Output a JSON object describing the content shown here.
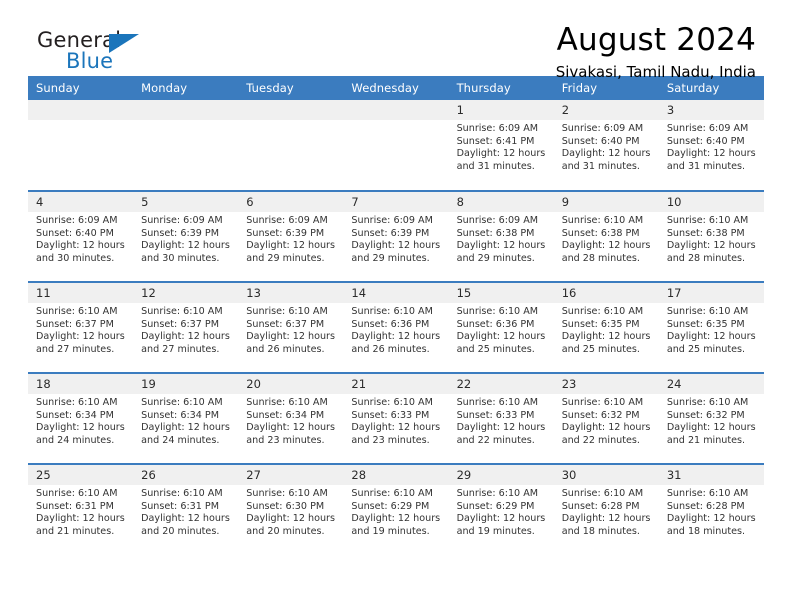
{
  "brand": {
    "name_part1": "General",
    "name_part2": "Blue",
    "triangle_icon": "triangle-icon",
    "color_dark": "#231f20",
    "color_blue": "#1b75bb"
  },
  "header": {
    "title": "August 2024",
    "subtitle": "Sivakasi, Tamil Nadu, India",
    "accent_color": "#3b7cbf",
    "daynum_bg": "#f0f0f0"
  },
  "weekday_headers": [
    "Sunday",
    "Monday",
    "Tuesday",
    "Wednesday",
    "Thursday",
    "Friday",
    "Saturday"
  ],
  "weeks": [
    [
      {
        "day": "",
        "sunrise": "",
        "sunset": "",
        "daylight_line1": "",
        "daylight_line2": ""
      },
      {
        "day": "",
        "sunrise": "",
        "sunset": "",
        "daylight_line1": "",
        "daylight_line2": ""
      },
      {
        "day": "",
        "sunrise": "",
        "sunset": "",
        "daylight_line1": "",
        "daylight_line2": ""
      },
      {
        "day": "",
        "sunrise": "",
        "sunset": "",
        "daylight_line1": "",
        "daylight_line2": ""
      },
      {
        "day": "1",
        "sunrise": "Sunrise: 6:09 AM",
        "sunset": "Sunset: 6:41 PM",
        "daylight_line1": "Daylight: 12 hours",
        "daylight_line2": "and 31 minutes."
      },
      {
        "day": "2",
        "sunrise": "Sunrise: 6:09 AM",
        "sunset": "Sunset: 6:40 PM",
        "daylight_line1": "Daylight: 12 hours",
        "daylight_line2": "and 31 minutes."
      },
      {
        "day": "3",
        "sunrise": "Sunrise: 6:09 AM",
        "sunset": "Sunset: 6:40 PM",
        "daylight_line1": "Daylight: 12 hours",
        "daylight_line2": "and 31 minutes."
      }
    ],
    [
      {
        "day": "4",
        "sunrise": "Sunrise: 6:09 AM",
        "sunset": "Sunset: 6:40 PM",
        "daylight_line1": "Daylight: 12 hours",
        "daylight_line2": "and 30 minutes."
      },
      {
        "day": "5",
        "sunrise": "Sunrise: 6:09 AM",
        "sunset": "Sunset: 6:39 PM",
        "daylight_line1": "Daylight: 12 hours",
        "daylight_line2": "and 30 minutes."
      },
      {
        "day": "6",
        "sunrise": "Sunrise: 6:09 AM",
        "sunset": "Sunset: 6:39 PM",
        "daylight_line1": "Daylight: 12 hours",
        "daylight_line2": "and 29 minutes."
      },
      {
        "day": "7",
        "sunrise": "Sunrise: 6:09 AM",
        "sunset": "Sunset: 6:39 PM",
        "daylight_line1": "Daylight: 12 hours",
        "daylight_line2": "and 29 minutes."
      },
      {
        "day": "8",
        "sunrise": "Sunrise: 6:09 AM",
        "sunset": "Sunset: 6:38 PM",
        "daylight_line1": "Daylight: 12 hours",
        "daylight_line2": "and 29 minutes."
      },
      {
        "day": "9",
        "sunrise": "Sunrise: 6:10 AM",
        "sunset": "Sunset: 6:38 PM",
        "daylight_line1": "Daylight: 12 hours",
        "daylight_line2": "and 28 minutes."
      },
      {
        "day": "10",
        "sunrise": "Sunrise: 6:10 AM",
        "sunset": "Sunset: 6:38 PM",
        "daylight_line1": "Daylight: 12 hours",
        "daylight_line2": "and 28 minutes."
      }
    ],
    [
      {
        "day": "11",
        "sunrise": "Sunrise: 6:10 AM",
        "sunset": "Sunset: 6:37 PM",
        "daylight_line1": "Daylight: 12 hours",
        "daylight_line2": "and 27 minutes."
      },
      {
        "day": "12",
        "sunrise": "Sunrise: 6:10 AM",
        "sunset": "Sunset: 6:37 PM",
        "daylight_line1": "Daylight: 12 hours",
        "daylight_line2": "and 27 minutes."
      },
      {
        "day": "13",
        "sunrise": "Sunrise: 6:10 AM",
        "sunset": "Sunset: 6:37 PM",
        "daylight_line1": "Daylight: 12 hours",
        "daylight_line2": "and 26 minutes."
      },
      {
        "day": "14",
        "sunrise": "Sunrise: 6:10 AM",
        "sunset": "Sunset: 6:36 PM",
        "daylight_line1": "Daylight: 12 hours",
        "daylight_line2": "and 26 minutes."
      },
      {
        "day": "15",
        "sunrise": "Sunrise: 6:10 AM",
        "sunset": "Sunset: 6:36 PM",
        "daylight_line1": "Daylight: 12 hours",
        "daylight_line2": "and 25 minutes."
      },
      {
        "day": "16",
        "sunrise": "Sunrise: 6:10 AM",
        "sunset": "Sunset: 6:35 PM",
        "daylight_line1": "Daylight: 12 hours",
        "daylight_line2": "and 25 minutes."
      },
      {
        "day": "17",
        "sunrise": "Sunrise: 6:10 AM",
        "sunset": "Sunset: 6:35 PM",
        "daylight_line1": "Daylight: 12 hours",
        "daylight_line2": "and 25 minutes."
      }
    ],
    [
      {
        "day": "18",
        "sunrise": "Sunrise: 6:10 AM",
        "sunset": "Sunset: 6:34 PM",
        "daylight_line1": "Daylight: 12 hours",
        "daylight_line2": "and 24 minutes."
      },
      {
        "day": "19",
        "sunrise": "Sunrise: 6:10 AM",
        "sunset": "Sunset: 6:34 PM",
        "daylight_line1": "Daylight: 12 hours",
        "daylight_line2": "and 24 minutes."
      },
      {
        "day": "20",
        "sunrise": "Sunrise: 6:10 AM",
        "sunset": "Sunset: 6:34 PM",
        "daylight_line1": "Daylight: 12 hours",
        "daylight_line2": "and 23 minutes."
      },
      {
        "day": "21",
        "sunrise": "Sunrise: 6:10 AM",
        "sunset": "Sunset: 6:33 PM",
        "daylight_line1": "Daylight: 12 hours",
        "daylight_line2": "and 23 minutes."
      },
      {
        "day": "22",
        "sunrise": "Sunrise: 6:10 AM",
        "sunset": "Sunset: 6:33 PM",
        "daylight_line1": "Daylight: 12 hours",
        "daylight_line2": "and 22 minutes."
      },
      {
        "day": "23",
        "sunrise": "Sunrise: 6:10 AM",
        "sunset": "Sunset: 6:32 PM",
        "daylight_line1": "Daylight: 12 hours",
        "daylight_line2": "and 22 minutes."
      },
      {
        "day": "24",
        "sunrise": "Sunrise: 6:10 AM",
        "sunset": "Sunset: 6:32 PM",
        "daylight_line1": "Daylight: 12 hours",
        "daylight_line2": "and 21 minutes."
      }
    ],
    [
      {
        "day": "25",
        "sunrise": "Sunrise: 6:10 AM",
        "sunset": "Sunset: 6:31 PM",
        "daylight_line1": "Daylight: 12 hours",
        "daylight_line2": "and 21 minutes."
      },
      {
        "day": "26",
        "sunrise": "Sunrise: 6:10 AM",
        "sunset": "Sunset: 6:31 PM",
        "daylight_line1": "Daylight: 12 hours",
        "daylight_line2": "and 20 minutes."
      },
      {
        "day": "27",
        "sunrise": "Sunrise: 6:10 AM",
        "sunset": "Sunset: 6:30 PM",
        "daylight_line1": "Daylight: 12 hours",
        "daylight_line2": "and 20 minutes."
      },
      {
        "day": "28",
        "sunrise": "Sunrise: 6:10 AM",
        "sunset": "Sunset: 6:29 PM",
        "daylight_line1": "Daylight: 12 hours",
        "daylight_line2": "and 19 minutes."
      },
      {
        "day": "29",
        "sunrise": "Sunrise: 6:10 AM",
        "sunset": "Sunset: 6:29 PM",
        "daylight_line1": "Daylight: 12 hours",
        "daylight_line2": "and 19 minutes."
      },
      {
        "day": "30",
        "sunrise": "Sunrise: 6:10 AM",
        "sunset": "Sunset: 6:28 PM",
        "daylight_line1": "Daylight: 12 hours",
        "daylight_line2": "and 18 minutes."
      },
      {
        "day": "31",
        "sunrise": "Sunrise: 6:10 AM",
        "sunset": "Sunset: 6:28 PM",
        "daylight_line1": "Daylight: 12 hours",
        "daylight_line2": "and 18 minutes."
      }
    ]
  ]
}
